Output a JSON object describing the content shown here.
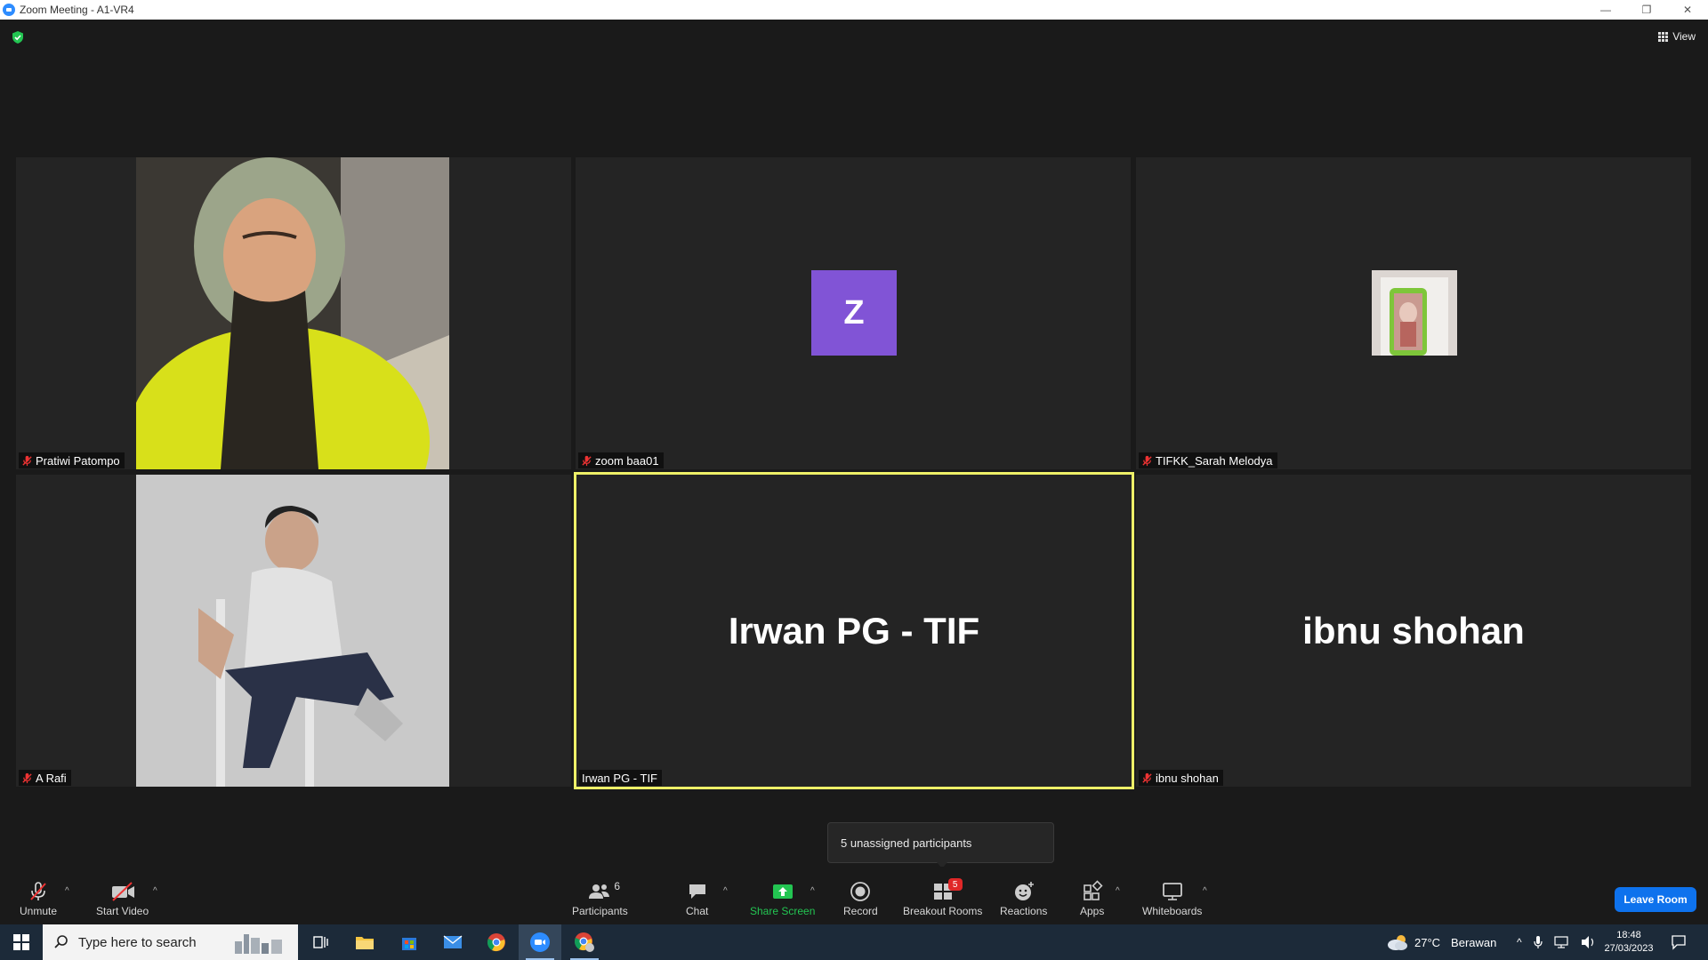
{
  "window": {
    "title": "Zoom Meeting - A1-VR4"
  },
  "top": {
    "view_label": "View"
  },
  "tiles": [
    {
      "name": "Pratiwi Patompo",
      "type": "video"
    },
    {
      "name": "zoom baa01",
      "type": "avatar",
      "avatar_letter": "Z"
    },
    {
      "name": "TIFKK_Sarah Melodya",
      "type": "profile-photo"
    },
    {
      "name": "A Rafi",
      "type": "video"
    },
    {
      "name": "Irwan PG - TIF",
      "type": "name-only",
      "display": "Irwan PG - TIF",
      "active_speaker": true
    },
    {
      "name": "ibnu shohan",
      "type": "name-only",
      "display": "ibnu shohan"
    }
  ],
  "tooltip": {
    "text": "5 unassigned participants"
  },
  "toolbar": {
    "unmute": "Unmute",
    "start_video": "Start Video",
    "participants": "Participants",
    "participants_count": "6",
    "chat": "Chat",
    "share_screen": "Share Screen",
    "record": "Record",
    "breakout_rooms": "Breakout Rooms",
    "breakout_badge": "5",
    "reactions": "Reactions",
    "apps": "Apps",
    "whiteboards": "Whiteboards",
    "leave": "Leave Room"
  },
  "taskbar": {
    "search_placeholder": "Type here to search",
    "weather_temp": "27°C",
    "weather_desc": "Berawan",
    "time": "18:48",
    "date": "27/03/2023"
  },
  "colors": {
    "accent_blue": "#0e72ed",
    "avatar_purple": "#8154d6",
    "active_speaker": "#eef068",
    "share_green": "#23c552",
    "badge_red": "#e02828"
  }
}
